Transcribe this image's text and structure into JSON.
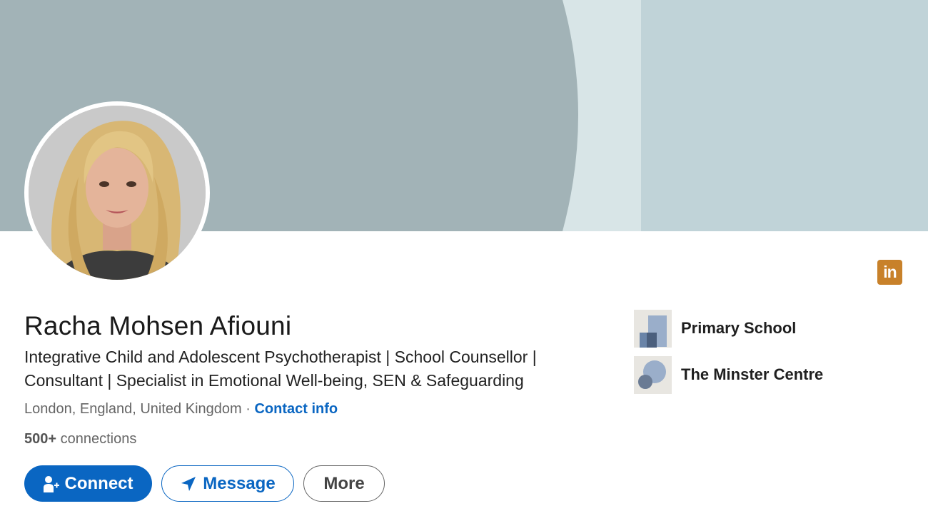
{
  "profile": {
    "name": "Racha Mohsen Afiouni",
    "headline": "Integrative Child and Adolescent Psychotherapist | School Counsellor | Consultant | Specialist in Emotional Well-being, SEN & Safeguarding",
    "location": "London, England, United Kingdom",
    "separator": "·",
    "contact_label": "Contact info",
    "connections_count": "500+",
    "connections_label": "connections",
    "avatar_icon": "profile-photo"
  },
  "brand": {
    "badge_text": "in",
    "badge_color": "#c8812a",
    "accent": "#0a66c2"
  },
  "actions": {
    "connect_label": "Connect",
    "message_label": "Message",
    "more_label": "More"
  },
  "organizations": [
    {
      "name": "Primary School"
    },
    {
      "name": "The Minster Centre"
    }
  ],
  "banner": {
    "colors": [
      "#a2b3b7",
      "#d8e5e7",
      "#c0d3d8"
    ]
  }
}
